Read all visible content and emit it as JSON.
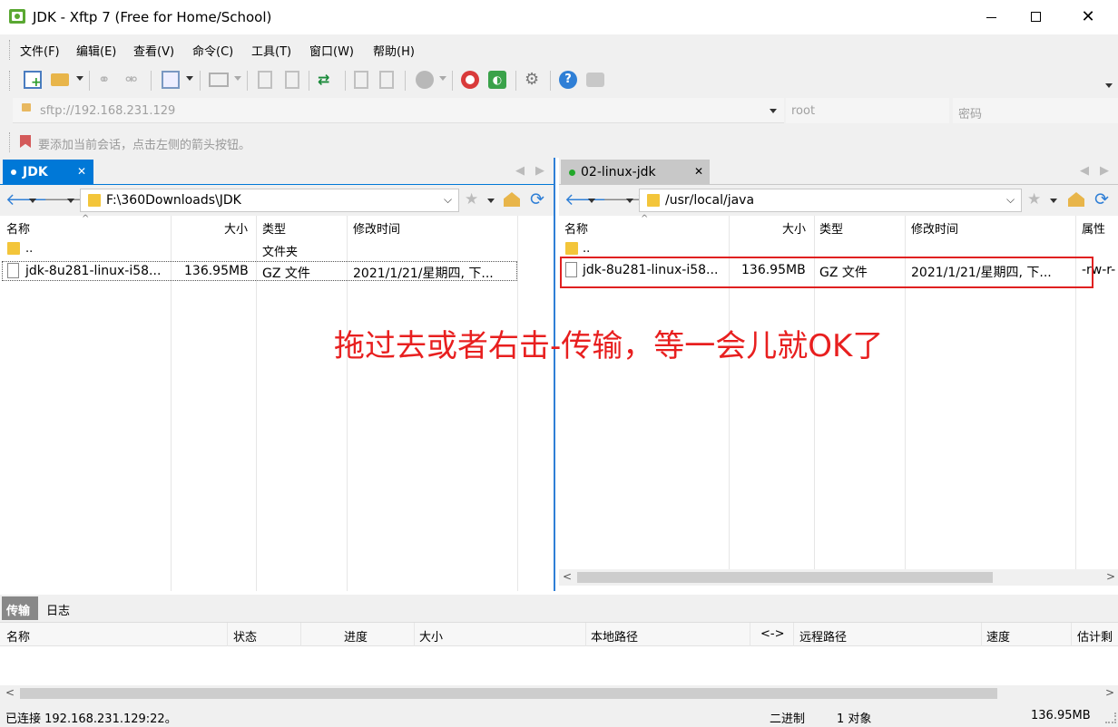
{
  "window": {
    "title": "JDK - Xftp 7 (Free for Home/School)"
  },
  "menu": [
    "文件(F)",
    "编辑(E)",
    "查看(V)",
    "命令(C)",
    "工具(T)",
    "窗口(W)",
    "帮助(H)"
  ],
  "address": {
    "host_placeholder": "sftp://192.168.231.129",
    "user_placeholder": "root",
    "password_placeholder": "密码"
  },
  "hint": "要添加当前会话，点击左侧的箭头按钮。",
  "left": {
    "tab": "JDK",
    "path": "F:\\360Downloads\\JDK",
    "columns": {
      "name": "名称",
      "size": "大小",
      "type": "类型",
      "modified": "修改时间"
    },
    "rows": [
      {
        "name": "..",
        "size": "",
        "type": "文件夹",
        "modified": ""
      },
      {
        "name": "jdk-8u281-linux-i58...",
        "size": "136.95MB",
        "type": "GZ 文件",
        "modified": "2021/1/21/星期四, 下..."
      }
    ]
  },
  "right": {
    "tab": "02-linux-jdk",
    "path": "/usr/local/java",
    "columns": {
      "name": "名称",
      "size": "大小",
      "type": "类型",
      "modified": "修改时间",
      "attr": "属性"
    },
    "rows": [
      {
        "name": "..",
        "size": "",
        "type": "",
        "modified": "",
        "attr": ""
      },
      {
        "name": "jdk-8u281-linux-i58...",
        "size": "136.95MB",
        "type": "GZ 文件",
        "modified": "2021/1/21/星期四, 下...",
        "attr": "-rw-r-"
      }
    ]
  },
  "annotation": "拖过去或者右击-传输，等一会儿就OK了",
  "transfer": {
    "tabs": [
      "传输",
      "日志"
    ],
    "columns": [
      "名称",
      "状态",
      "进度",
      "大小",
      "本地路径",
      "<->",
      "远程路径",
      "速度",
      "估计剩"
    ]
  },
  "status": {
    "connected": "已连接 192.168.231.129:22。",
    "mode": "二进制",
    "objects": "1 对象",
    "size": "136.95MB"
  },
  "colors": {
    "accent": "#0078d7",
    "annotation": "#e81f1f",
    "highlight_box": "#e02020"
  }
}
